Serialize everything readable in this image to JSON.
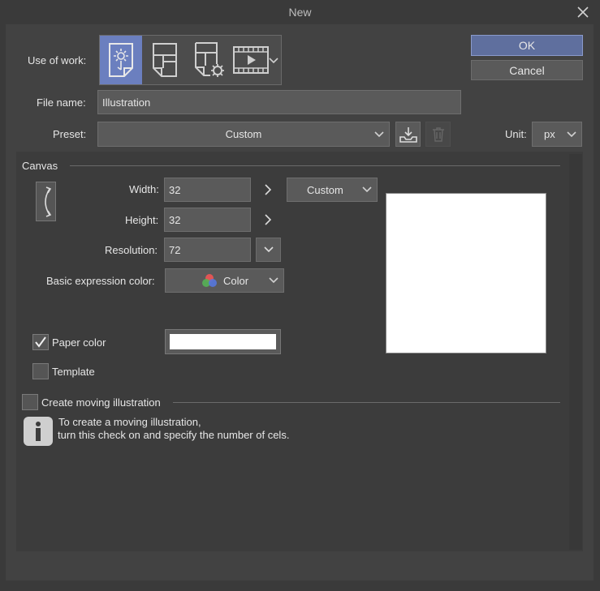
{
  "window": {
    "title": "New"
  },
  "buttons": {
    "ok": "OK",
    "cancel": "Cancel"
  },
  "use_of_work": {
    "label": "Use of work:",
    "options": [
      {
        "icon": "illustration-icon",
        "selected": true
      },
      {
        "icon": "comic-icon",
        "selected": false
      },
      {
        "icon": "comic-settings-icon",
        "selected": false
      },
      {
        "icon": "animation-icon",
        "selected": false
      }
    ]
  },
  "file_name": {
    "label": "File name:",
    "value": "Illustration"
  },
  "preset": {
    "label": "Preset:",
    "value": "Custom"
  },
  "unit": {
    "label": "Unit:",
    "value": "px"
  },
  "canvas": {
    "section_label": "Canvas",
    "width_label": "Width:",
    "width_value": "32",
    "height_label": "Height:",
    "height_value": "32",
    "size_preset": "Custom",
    "resolution_label": "Resolution:",
    "resolution_value": "72",
    "expression_label": "Basic expression color:",
    "expression_value": "Color",
    "paper_color_label": "Paper color",
    "paper_color_checked": true,
    "paper_color": "#ffffff",
    "template_label": "Template",
    "template_checked": false
  },
  "moving": {
    "label": "Create moving illustration",
    "checked": false,
    "info_line1": "To create a moving illustration,",
    "info_line2": "turn this check on and specify the number of cels."
  },
  "colors": {
    "accent": "#6b7fbf",
    "ok_button": "#5f6f9e"
  }
}
